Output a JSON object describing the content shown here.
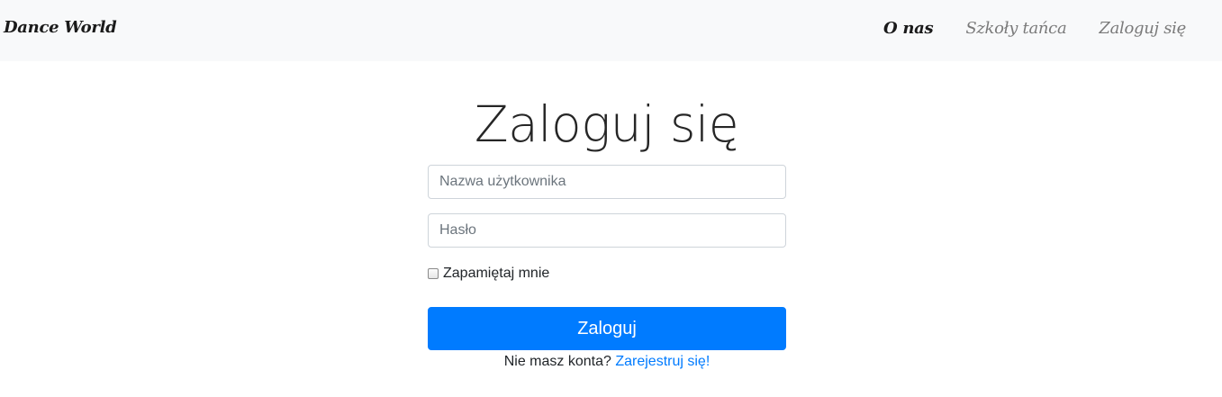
{
  "navbar": {
    "brand": "Dance World",
    "links": [
      {
        "label": "O nas",
        "active": true
      },
      {
        "label": "Szkoły tańca",
        "active": false
      },
      {
        "label": "Zaloguj się",
        "active": false
      }
    ]
  },
  "login": {
    "title": "Zaloguj się",
    "username": {
      "placeholder": "Nazwa użytkownika",
      "value": ""
    },
    "password": {
      "placeholder": "Hasło",
      "value": ""
    },
    "remember_label": "Zapamiętaj mnie",
    "remember_checked": false,
    "submit_label": "Zaloguj",
    "no_account_text": "Nie masz konta?",
    "register_link": "Zarejestruj się!"
  },
  "colors": {
    "navbar_bg": "#f8f9fa",
    "primary": "#007bff"
  }
}
